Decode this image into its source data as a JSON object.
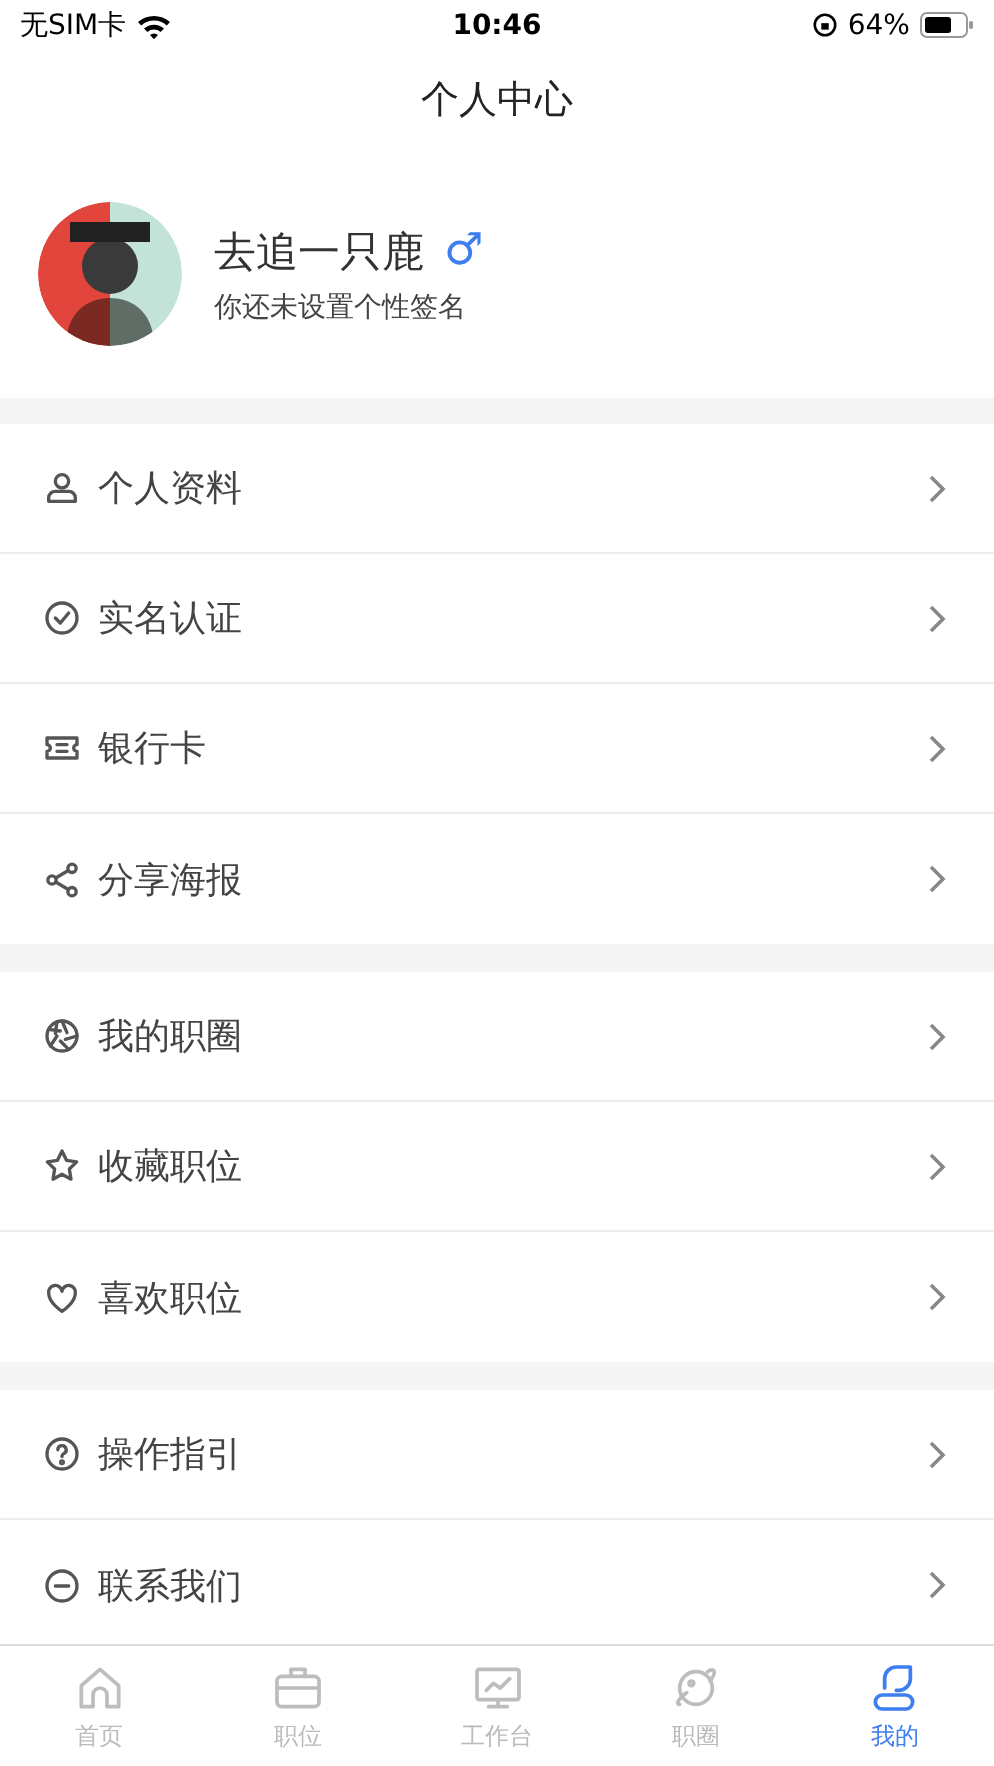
{
  "status_bar": {
    "carrier": "无SIM卡",
    "time": "10:46",
    "battery": "64%"
  },
  "nav": {
    "title": "个人中心"
  },
  "profile": {
    "name": "去追一只鹿",
    "gender": "♂",
    "signature": "你还未设置个性签名"
  },
  "sections": [
    {
      "items": [
        {
          "label": "个人资料"
        },
        {
          "label": "实名认证"
        },
        {
          "label": "银行卡"
        },
        {
          "label": "分享海报"
        }
      ]
    },
    {
      "items": [
        {
          "label": "我的职圈"
        },
        {
          "label": "收藏职位"
        },
        {
          "label": "喜欢职位"
        }
      ]
    },
    {
      "items": [
        {
          "label": "操作指引"
        },
        {
          "label": "联系我们"
        }
      ]
    }
  ],
  "tab_bar": [
    {
      "label": "首页",
      "selected": false
    },
    {
      "label": "职位",
      "selected": false
    },
    {
      "label": "工作台",
      "selected": false
    },
    {
      "label": "职圈",
      "selected": false
    },
    {
      "label": "我的",
      "selected": true
    }
  ]
}
